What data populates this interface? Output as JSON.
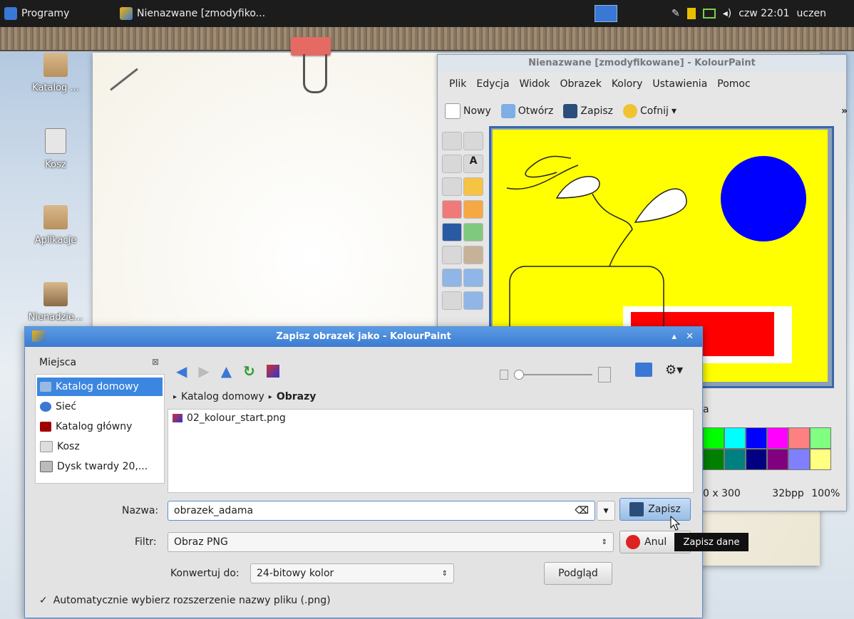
{
  "taskbar": {
    "menu_label": "Programy",
    "window_label": "Nienazwane [zmodyfiko...",
    "clock": "czw 22:01",
    "user": "uczen"
  },
  "desktop": {
    "icons": [
      {
        "label": "Katalog ..."
      },
      {
        "label": "Kosz"
      },
      {
        "label": "Aplikacje"
      },
      {
        "label": "Nienadzie..."
      }
    ]
  },
  "kolourpaint": {
    "title": "Nienazwane [zmodyfikowane] - KolourPaint",
    "menu": [
      "Plik",
      "Edycja",
      "Widok",
      "Obrazek",
      "Kolory",
      "Ustawienia",
      "Pomoc"
    ],
    "toolbar": {
      "new": "Nowy",
      "open": "Otwórz",
      "save": "Zapisz",
      "undo": "Cofnij"
    },
    "palette": [
      "#00ff00",
      "#00ffff",
      "#0000ff",
      "#ff00ff",
      "#ff8080",
      "#80ff80",
      "#008000",
      "#008080",
      "#000080",
      "#800080",
      "#8080ff",
      "#ffff80"
    ],
    "status_size": "0 x 300",
    "status_bpp": "32bpp",
    "status_zoom": "100%",
    "palette_label": "a"
  },
  "dialog": {
    "title": "Zapisz obrazek jako - KolourPaint",
    "places_title": "Miejsca",
    "places": [
      "Katalog domowy",
      "Sieć",
      "Katalog główny",
      "Kosz",
      "Dysk twardy 20,..."
    ],
    "breadcrumb_home": "Katalog domowy",
    "breadcrumb_current": "Obrazy",
    "files": [
      "02_kolour_start.png"
    ],
    "name_label": "Nazwa:",
    "name_value": "obrazek_adama",
    "filter_label": "Filtr:",
    "filter_value": "Obraz PNG",
    "convert_label": "Konwertuj do:",
    "convert_value": "24-bitowy kolor",
    "preview_button": "Podgląd",
    "save_button": "Zapisz",
    "cancel_button": "Anul",
    "auto_ext_label": "Automatycznie wybierz rozszerzenie nazwy pliku (.png)",
    "auto_ext_checked": true,
    "tooltip": "Zapisz dane"
  }
}
